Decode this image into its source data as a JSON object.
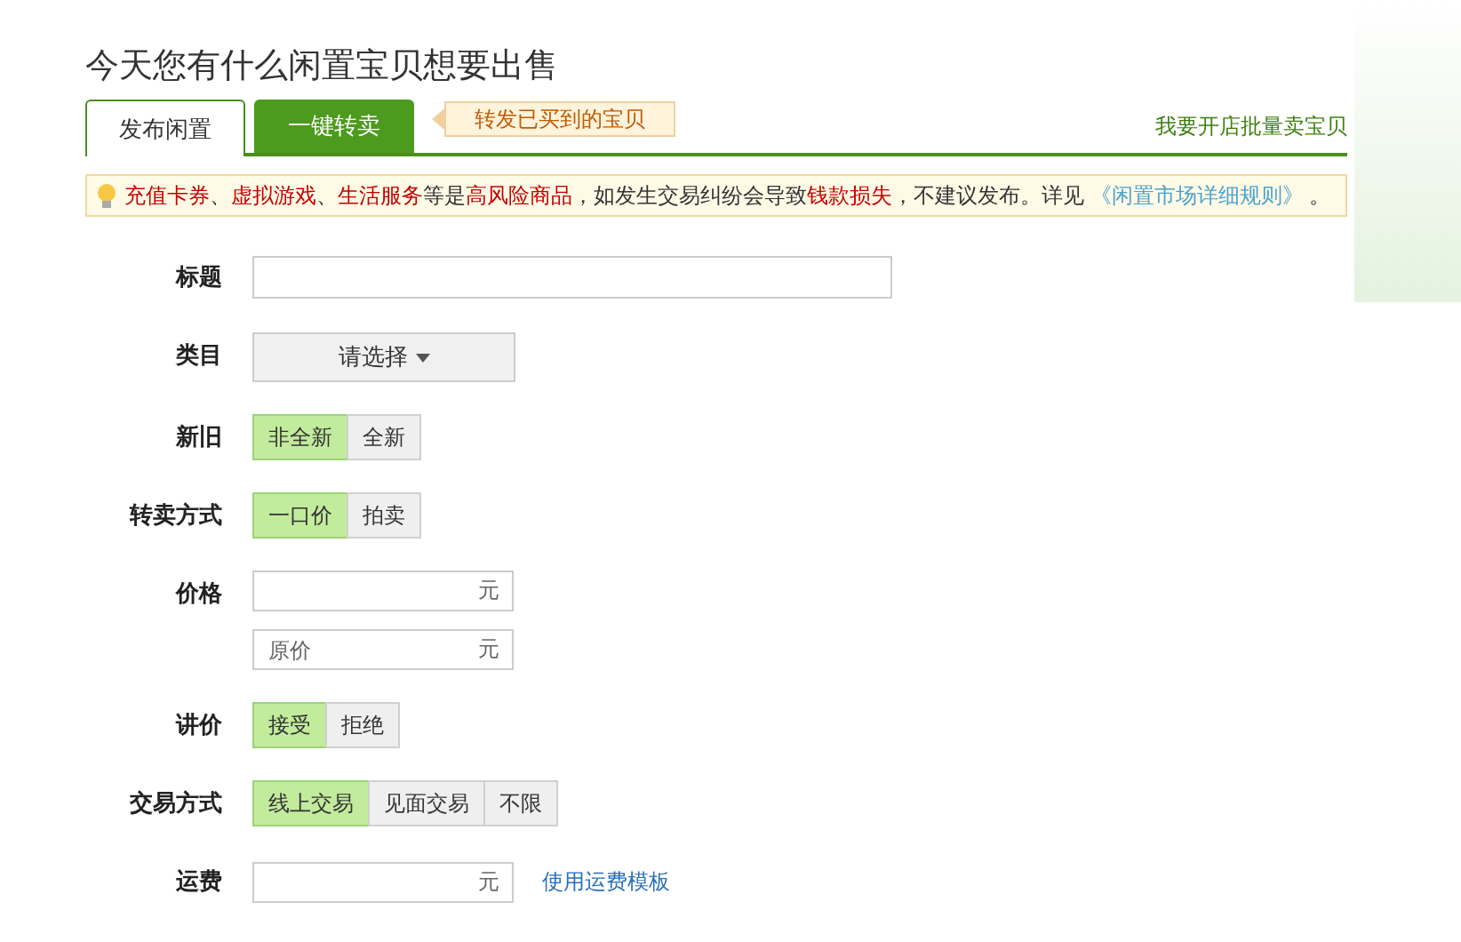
{
  "heading": "今天您有什么闲置宝贝想要出售",
  "tabs": [
    {
      "label": "发布闲置",
      "selected": true
    },
    {
      "label": "一键转卖",
      "selected": false
    }
  ],
  "tab_hint": "转发已买到的宝贝",
  "shop_link": "我要开店批量卖宝贝",
  "notice": [
    {
      "kind": "red",
      "text": "充值卡券"
    },
    {
      "kind": "plain",
      "text": "、"
    },
    {
      "kind": "red",
      "text": "虚拟游戏"
    },
    {
      "kind": "plain",
      "text": "、"
    },
    {
      "kind": "red",
      "text": "生活服务"
    },
    {
      "kind": "plain",
      "text": "等是"
    },
    {
      "kind": "red",
      "text": "高风险商品"
    },
    {
      "kind": "plain",
      "text": "，如发生交易纠纷会导致"
    },
    {
      "kind": "red",
      "text": "钱款损失"
    },
    {
      "kind": "plain",
      "text": "，不建议发布。详见 "
    },
    {
      "kind": "link",
      "text": "《闲置市场详细规则》"
    },
    {
      "kind": "plain",
      "text": " 。"
    }
  ],
  "fields": [
    {
      "kind": "text",
      "label": "标题"
    },
    {
      "kind": "select",
      "label": "类目",
      "value": "请选择"
    },
    {
      "kind": "toggle",
      "label": "新旧",
      "options": [
        {
          "label": "非全新",
          "selected": true
        },
        {
          "label": "全新",
          "selected": false
        }
      ]
    },
    {
      "kind": "toggle",
      "label": "转卖方式",
      "options": [
        {
          "label": "一口价",
          "selected": true
        },
        {
          "label": "拍卖",
          "selected": false
        }
      ]
    },
    {
      "kind": "money",
      "label": "价格",
      "inputs": [
        {
          "unit": "元"
        },
        {
          "placeholder": "原价",
          "unit": "元"
        }
      ]
    },
    {
      "kind": "toggle",
      "label": "讲价",
      "options": [
        {
          "label": "接受",
          "selected": true
        },
        {
          "label": "拒绝",
          "selected": false
        }
      ]
    },
    {
      "kind": "toggle",
      "label": "交易方式",
      "options": [
        {
          "label": "线上交易",
          "selected": true
        },
        {
          "label": "见面交易",
          "selected": false
        },
        {
          "label": "不限",
          "selected": false
        }
      ]
    },
    {
      "kind": "money",
      "label": "运费",
      "inputs": [
        {
          "unit": "元"
        }
      ],
      "link": "使用运费模板"
    }
  ]
}
